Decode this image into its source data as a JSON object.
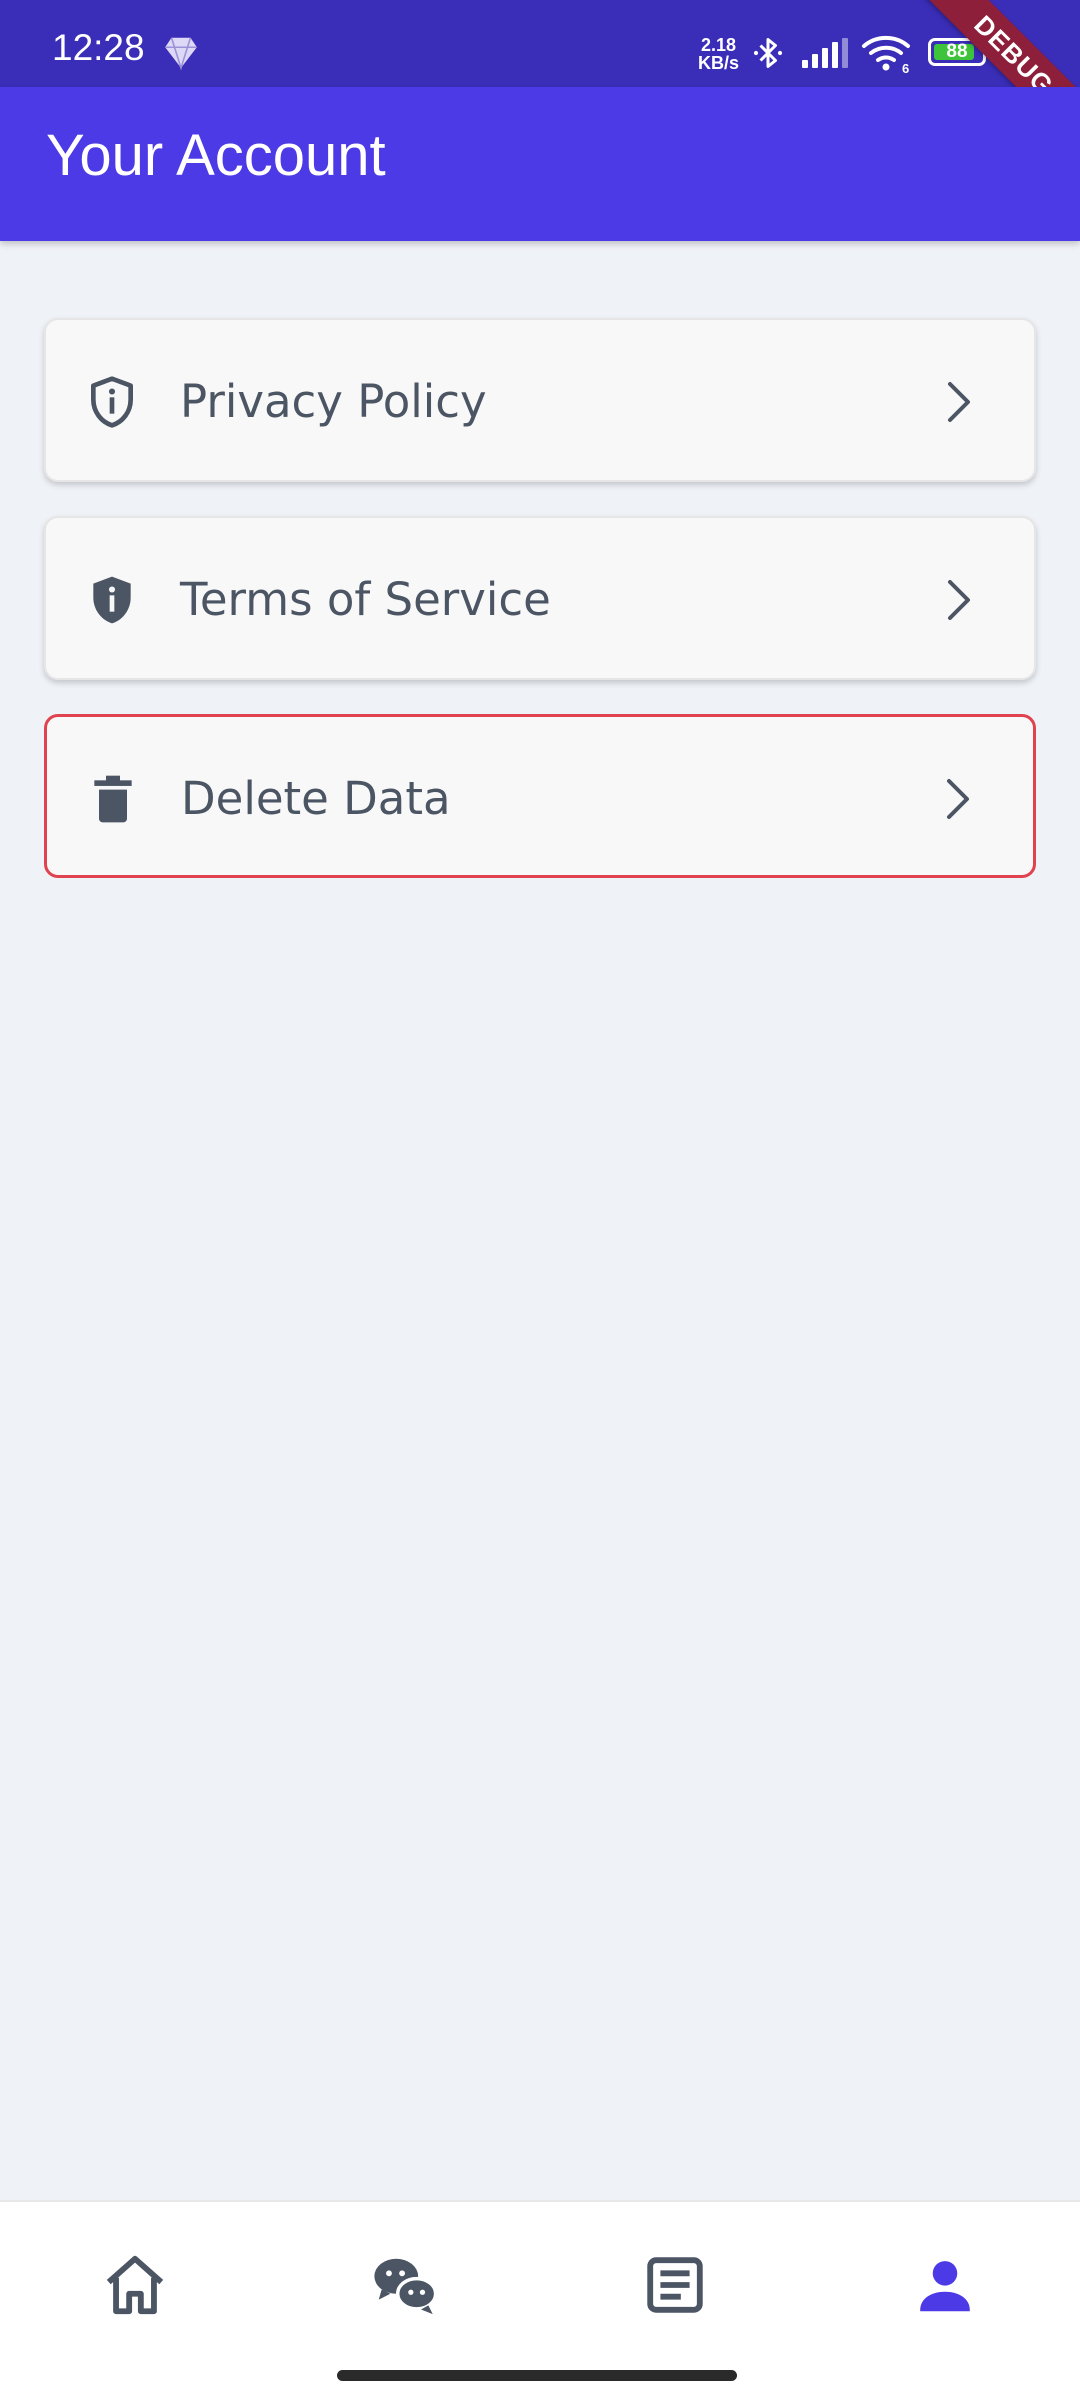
{
  "status_bar": {
    "time": "12:28",
    "net_speed_value": "2.18",
    "net_speed_unit": "KB/s",
    "wifi_label": "6",
    "battery_level": "88",
    "battery_fraction": 0.88
  },
  "debug_banner": "DEBUG",
  "app_bar": {
    "title": "Your Account"
  },
  "menu": {
    "items": [
      {
        "label": "Privacy Policy",
        "icon": "shield-info-outline-icon"
      },
      {
        "label": "Terms of Service",
        "icon": "shield-info-filled-icon"
      },
      {
        "label": "Delete Data",
        "icon": "trash-icon"
      }
    ]
  },
  "bottom_nav": {
    "items": [
      {
        "name": "home",
        "icon": "home-icon",
        "active": false
      },
      {
        "name": "chat",
        "icon": "chat-icon",
        "active": false
      },
      {
        "name": "articles",
        "icon": "article-icon",
        "active": false
      },
      {
        "name": "account",
        "icon": "person-icon",
        "active": true
      }
    ]
  },
  "colors": {
    "status_bar": "#3a2db8",
    "app_bar": "#4d3ae7",
    "background": "#eff2f7",
    "danger_border": "#e0424f",
    "icon_gray": "#4b5563",
    "nav_active": "#4d3ae7"
  }
}
